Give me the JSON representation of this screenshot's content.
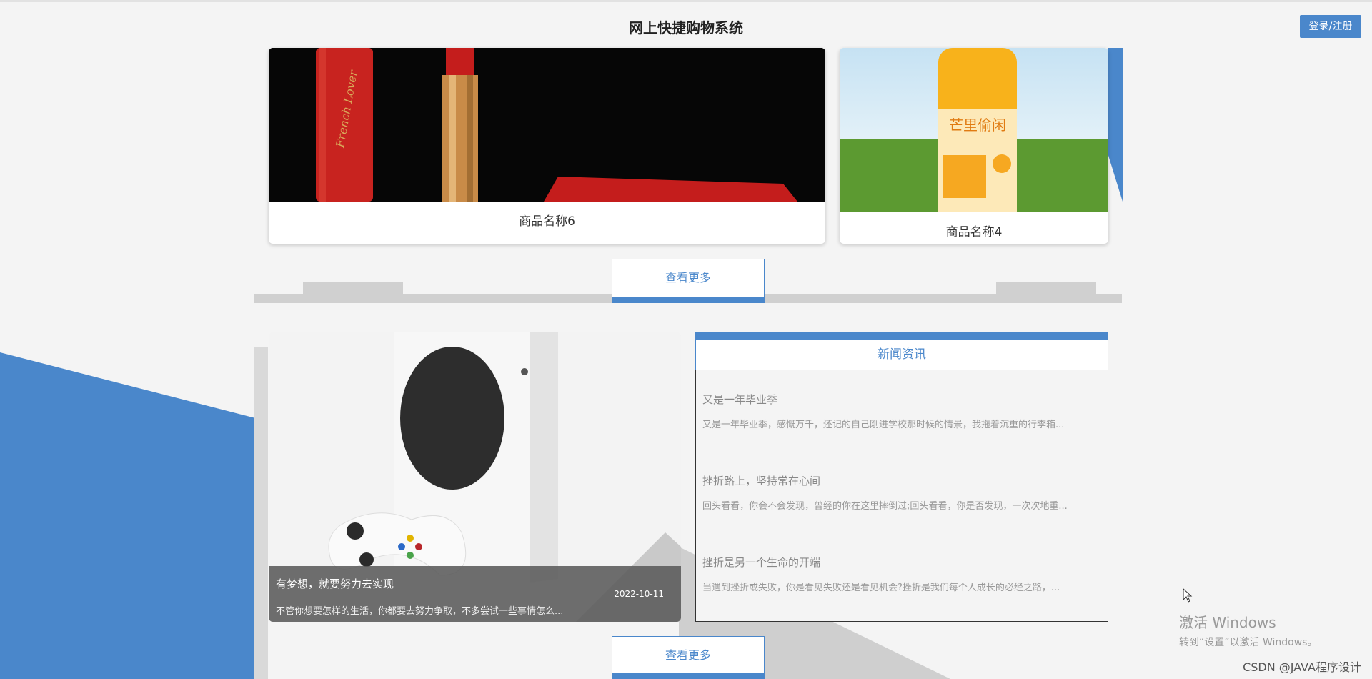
{
  "header": {
    "title": "网上快捷购物系统",
    "login_label": "登录/注册"
  },
  "products": [
    {
      "name": "商品名称6",
      "image": "lipstick-photo"
    },
    {
      "name": "商品名称4",
      "image": "mango-juice-photo"
    }
  ],
  "more_label_1": "查看更多",
  "more_label_2": "查看更多",
  "feature": {
    "image": "game-console-photo",
    "title": "有梦想，就要努力去实现",
    "date": "2022-10-11",
    "desc": "不管你想要怎样的生活，你都要去努力争取，不多尝试一些事情怎么..."
  },
  "news": {
    "heading": "新闻资讯",
    "items": [
      {
        "title": "又是一年毕业季",
        "desc": "又是一年毕业季，感慨万千，还记的自己刚进学校那时候的情景，我拖着沉重的行李箱..."
      },
      {
        "title": "挫折路上，坚持常在心间",
        "desc": "回头看看，你会不会发现，曾经的你在这里摔倒过;回头看看，你是否发现，一次次地重..."
      },
      {
        "title": "挫折是另一个生命的开端",
        "desc": "当遇到挫折或失败，你是看见失败还是看见机会?挫折是我们每个人成长的必经之路，..."
      }
    ]
  },
  "overlay": {
    "activate_title": "激活 Windows",
    "activate_sub": "转到“设置”以激活 Windows。",
    "watermark": "CSDN @JAVA程序设计"
  },
  "colors": {
    "accent": "#4a87cb"
  }
}
